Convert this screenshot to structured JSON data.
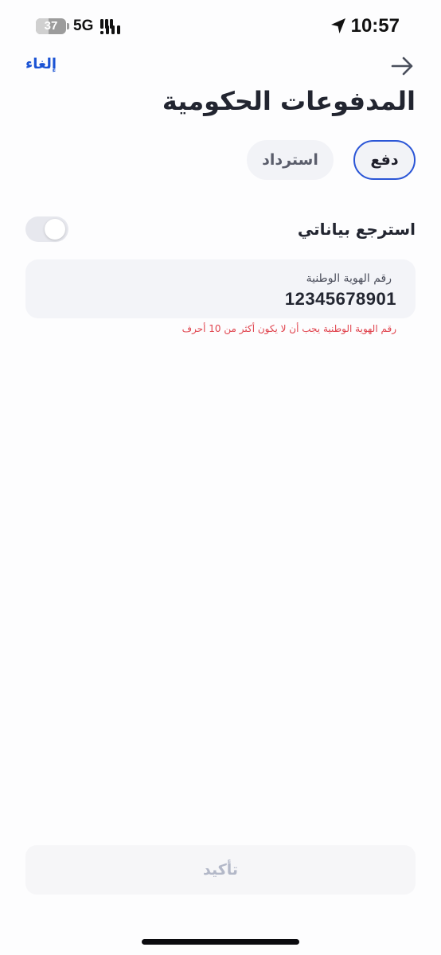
{
  "status_bar": {
    "battery_level": "37",
    "network": "5G",
    "time": "10:57",
    "icons": [
      "battery-icon",
      "signal-bars-icon",
      "location-arrow-icon"
    ]
  },
  "header": {
    "cancel_label": "إلغاء",
    "back_icon": "arrow-right-icon",
    "title": "المدفوعات الحكومية"
  },
  "tabs": [
    {
      "label": "دفع",
      "selected": true
    },
    {
      "label": "استرداد",
      "selected": false
    }
  ],
  "retrieve_data": {
    "label": "استرجع بياناتي",
    "enabled": false
  },
  "national_id": {
    "label": "رقم الهوية الوطنية",
    "value": "12345678901",
    "error": "رقم الهوية الوطنية يجب أن لا يكون أكثر من 10 أحرف"
  },
  "confirm": {
    "label": "تأكيد",
    "enabled": false
  },
  "colors": {
    "accent": "#1b53d4",
    "error": "#e0444e",
    "disabled_text": "#b3b8c8"
  }
}
